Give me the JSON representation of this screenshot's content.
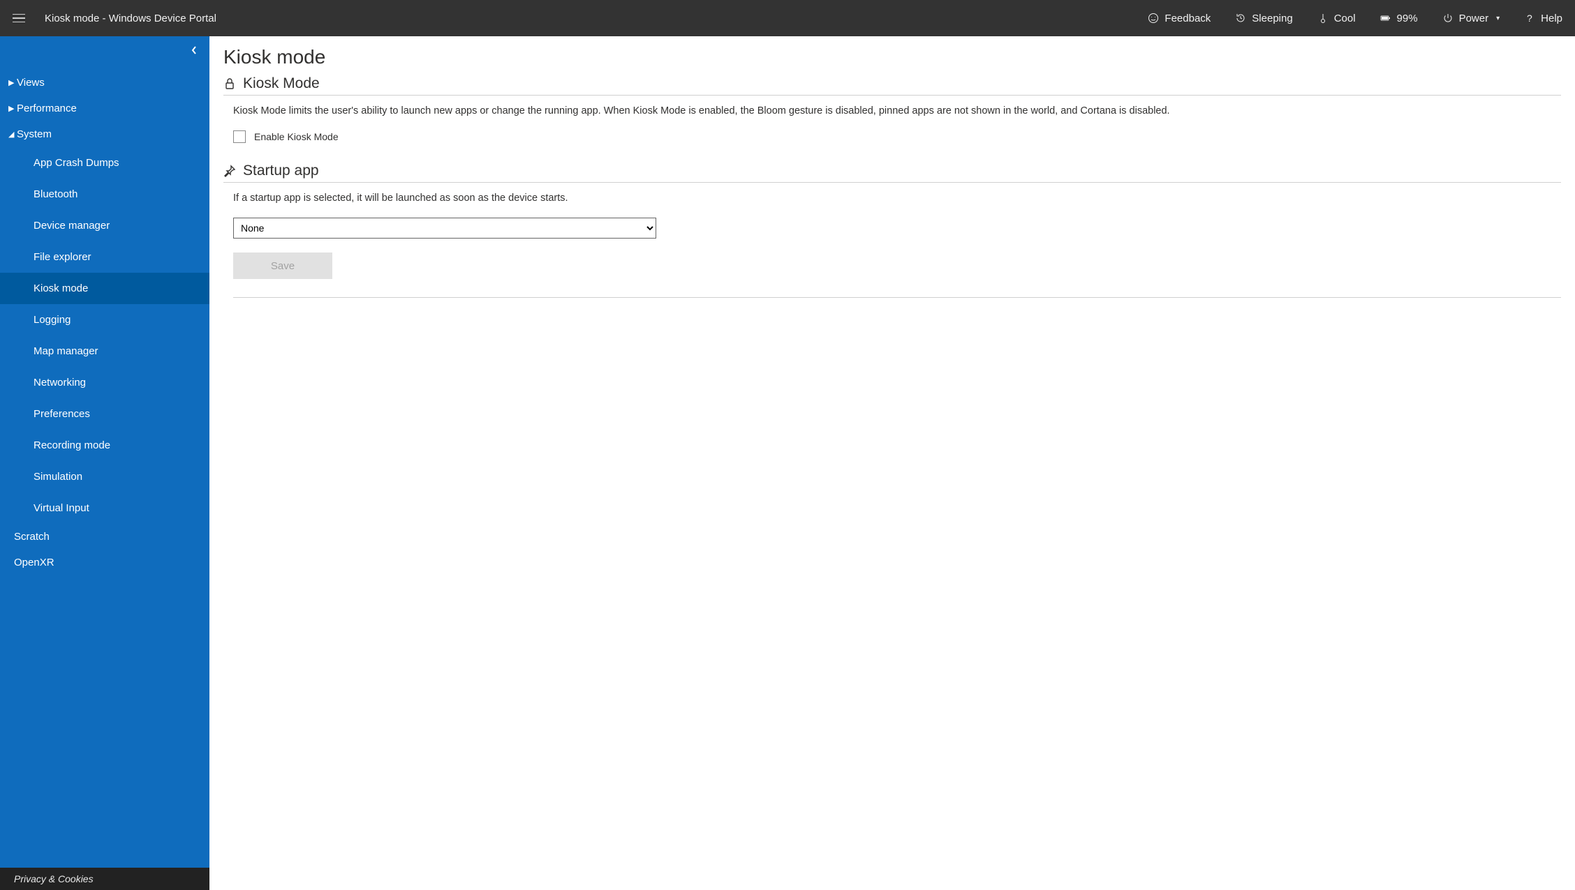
{
  "header": {
    "title": "Kiosk mode - Windows Device Portal",
    "feedback": "Feedback",
    "sleeping": "Sleeping",
    "cool": "Cool",
    "battery": "99%",
    "power": "Power",
    "help": "Help"
  },
  "sidebar": {
    "views": "Views",
    "performance": "Performance",
    "system": "System",
    "system_items": [
      "App Crash Dumps",
      "Bluetooth",
      "Device manager",
      "File explorer",
      "Kiosk mode",
      "Logging",
      "Map manager",
      "Networking",
      "Preferences",
      "Recording mode",
      "Simulation",
      "Virtual Input"
    ],
    "scratch": "Scratch",
    "openxr": "OpenXR",
    "footer": "Privacy & Cookies"
  },
  "main": {
    "page_title": "Kiosk mode",
    "section1_title": "Kiosk Mode",
    "section1_desc": "Kiosk Mode limits the user's ability to launch new apps or change the running app. When Kiosk Mode is enabled, the Bloom gesture is disabled, pinned apps are not shown in the world, and Cortana is disabled.",
    "checkbox_label": "Enable Kiosk Mode",
    "section2_title": "Startup app",
    "section2_desc": "If a startup app is selected, it will be launched as soon as the device starts.",
    "select_value": "None",
    "save_label": "Save"
  }
}
